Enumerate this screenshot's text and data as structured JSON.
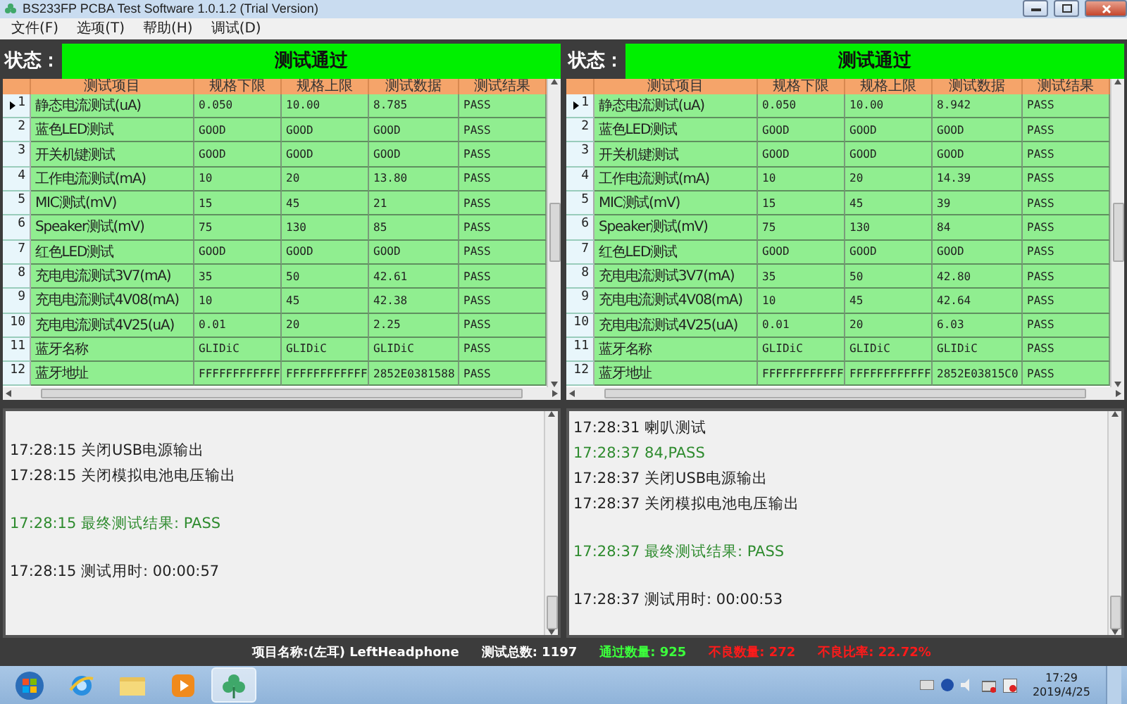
{
  "window": {
    "title": "BS233FP PCBA Test Software 1.0.1.2 (Trial Version)"
  },
  "menu": [
    "文件(F)",
    "选项(T)",
    "帮助(H)",
    "调试(D)"
  ],
  "panels": [
    {
      "status_label": "状态：",
      "status": "测试通过",
      "columns": [
        "测试项目",
        "规格下限",
        "规格上限",
        "测试数据",
        "测试结果"
      ],
      "rows": [
        {
          "index": "1",
          "selected": true,
          "cells": [
            "静态电流测试(uA)",
            "0.050",
            "10.00",
            "8.785",
            "PASS"
          ]
        },
        {
          "index": "2",
          "selected": false,
          "cells": [
            "蓝色LED测试",
            "GOOD",
            "GOOD",
            "GOOD",
            "PASS"
          ]
        },
        {
          "index": "3",
          "selected": false,
          "cells": [
            "开关机键测试",
            "GOOD",
            "GOOD",
            "GOOD",
            "PASS"
          ]
        },
        {
          "index": "4",
          "selected": false,
          "cells": [
            "工作电流测试(mA)",
            "10",
            "20",
            "13.80",
            "PASS"
          ]
        },
        {
          "index": "5",
          "selected": false,
          "cells": [
            "MIC测试(mV)",
            "15",
            "45",
            "21",
            "PASS"
          ]
        },
        {
          "index": "6",
          "selected": false,
          "cells": [
            "Speaker测试(mV)",
            "75",
            "130",
            "85",
            "PASS"
          ]
        },
        {
          "index": "7",
          "selected": false,
          "cells": [
            "红色LED测试",
            "GOOD",
            "GOOD",
            "GOOD",
            "PASS"
          ]
        },
        {
          "index": "8",
          "selected": false,
          "cells": [
            "充电电流测试3V7(mA)",
            "35",
            "50",
            "42.61",
            "PASS"
          ]
        },
        {
          "index": "9",
          "selected": false,
          "cells": [
            "充电电流测试4V08(mA)",
            "10",
            "45",
            "42.38",
            "PASS"
          ]
        },
        {
          "index": "10",
          "selected": false,
          "cells": [
            "充电电流测试4V25(uA)",
            "0.01",
            "20",
            "2.25",
            "PASS"
          ]
        },
        {
          "index": "11",
          "selected": false,
          "cells": [
            "蓝牙名称",
            "GLIDiC",
            "GLIDiC",
            "GLIDiC",
            "PASS"
          ]
        },
        {
          "index": "12",
          "selected": false,
          "cells": [
            "蓝牙地址",
            "FFFFFFFFFFFF",
            "FFFFFFFFFFFF",
            "2852E0381588",
            "PASS"
          ]
        }
      ],
      "log": [
        {
          "time": "17:28:15",
          "text": "关闭USB电源输出",
          "kind": "info",
          "gap_before": true
        },
        {
          "time": "17:28:15",
          "text": "关闭模拟电池电压输出",
          "kind": "info",
          "gap_before": false
        },
        {
          "time": "17:28:15",
          "text": "最终测试结果: PASS",
          "kind": "pass",
          "gap_before": true
        },
        {
          "time": "17:28:15",
          "text": "测试用时: 00:00:57",
          "kind": "info",
          "gap_before": true
        }
      ]
    },
    {
      "status_label": "状态：",
      "status": "测试通过",
      "columns": [
        "测试项目",
        "规格下限",
        "规格上限",
        "测试数据",
        "测试结果"
      ],
      "rows": [
        {
          "index": "1",
          "selected": true,
          "cells": [
            "静态电流测试(uA)",
            "0.050",
            "10.00",
            "8.942",
            "PASS"
          ]
        },
        {
          "index": "2",
          "selected": false,
          "cells": [
            "蓝色LED测试",
            "GOOD",
            "GOOD",
            "GOOD",
            "PASS"
          ]
        },
        {
          "index": "3",
          "selected": false,
          "cells": [
            "开关机键测试",
            "GOOD",
            "GOOD",
            "GOOD",
            "PASS"
          ]
        },
        {
          "index": "4",
          "selected": false,
          "cells": [
            "工作电流测试(mA)",
            "10",
            "20",
            "14.39",
            "PASS"
          ]
        },
        {
          "index": "5",
          "selected": false,
          "cells": [
            "MIC测试(mV)",
            "15",
            "45",
            "39",
            "PASS"
          ]
        },
        {
          "index": "6",
          "selected": false,
          "cells": [
            "Speaker测试(mV)",
            "75",
            "130",
            "84",
            "PASS"
          ]
        },
        {
          "index": "7",
          "selected": false,
          "cells": [
            "红色LED测试",
            "GOOD",
            "GOOD",
            "GOOD",
            "PASS"
          ]
        },
        {
          "index": "8",
          "selected": false,
          "cells": [
            "充电电流测试3V7(mA)",
            "35",
            "50",
            "42.80",
            "PASS"
          ]
        },
        {
          "index": "9",
          "selected": false,
          "cells": [
            "充电电流测试4V08(mA)",
            "10",
            "45",
            "42.64",
            "PASS"
          ]
        },
        {
          "index": "10",
          "selected": false,
          "cells": [
            "充电电流测试4V25(uA)",
            "0.01",
            "20",
            "6.03",
            "PASS"
          ]
        },
        {
          "index": "11",
          "selected": false,
          "cells": [
            "蓝牙名称",
            "GLIDiC",
            "GLIDiC",
            "GLIDiC",
            "PASS"
          ]
        },
        {
          "index": "12",
          "selected": false,
          "cells": [
            "蓝牙地址",
            "FFFFFFFFFFFF",
            "FFFFFFFFFFFF",
            "2852E03815C0",
            "PASS"
          ]
        }
      ],
      "log": [
        {
          "time": "17:28:31",
          "text": "喇叭测试",
          "kind": "info",
          "gap_before": false
        },
        {
          "time": "17:28:37",
          "text": "84,PASS",
          "kind": "pass",
          "gap_before": false
        },
        {
          "time": "17:28:37",
          "text": "关闭USB电源输出",
          "kind": "info",
          "gap_before": false
        },
        {
          "time": "17:28:37",
          "text": "关闭模拟电池电压输出",
          "kind": "info",
          "gap_before": false
        },
        {
          "time": "17:28:37",
          "text": "最终测试结果: PASS",
          "kind": "pass",
          "gap_before": true
        },
        {
          "time": "17:28:37",
          "text": "测试用时: 00:00:53",
          "kind": "info",
          "gap_before": true
        }
      ]
    }
  ],
  "summary": [
    {
      "text": "项目名称:(左耳) LeftHeadphone",
      "kind": "info"
    },
    {
      "text": "测试总数: 1197",
      "kind": "info"
    },
    {
      "text": "通过数量: 925",
      "kind": "pass"
    },
    {
      "text": "不良数量: 272",
      "kind": "fail"
    },
    {
      "text": "不良比率: 22.72%",
      "kind": "fail"
    }
  ],
  "taskbar": {
    "apps": [
      {
        "kind": "browser",
        "selected": false
      },
      {
        "kind": "folder",
        "selected": false
      },
      {
        "kind": "player",
        "selected": false
      },
      {
        "kind": "clover",
        "selected": true
      }
    ],
    "time": "17:29",
    "date": "2019/4/25"
  }
}
